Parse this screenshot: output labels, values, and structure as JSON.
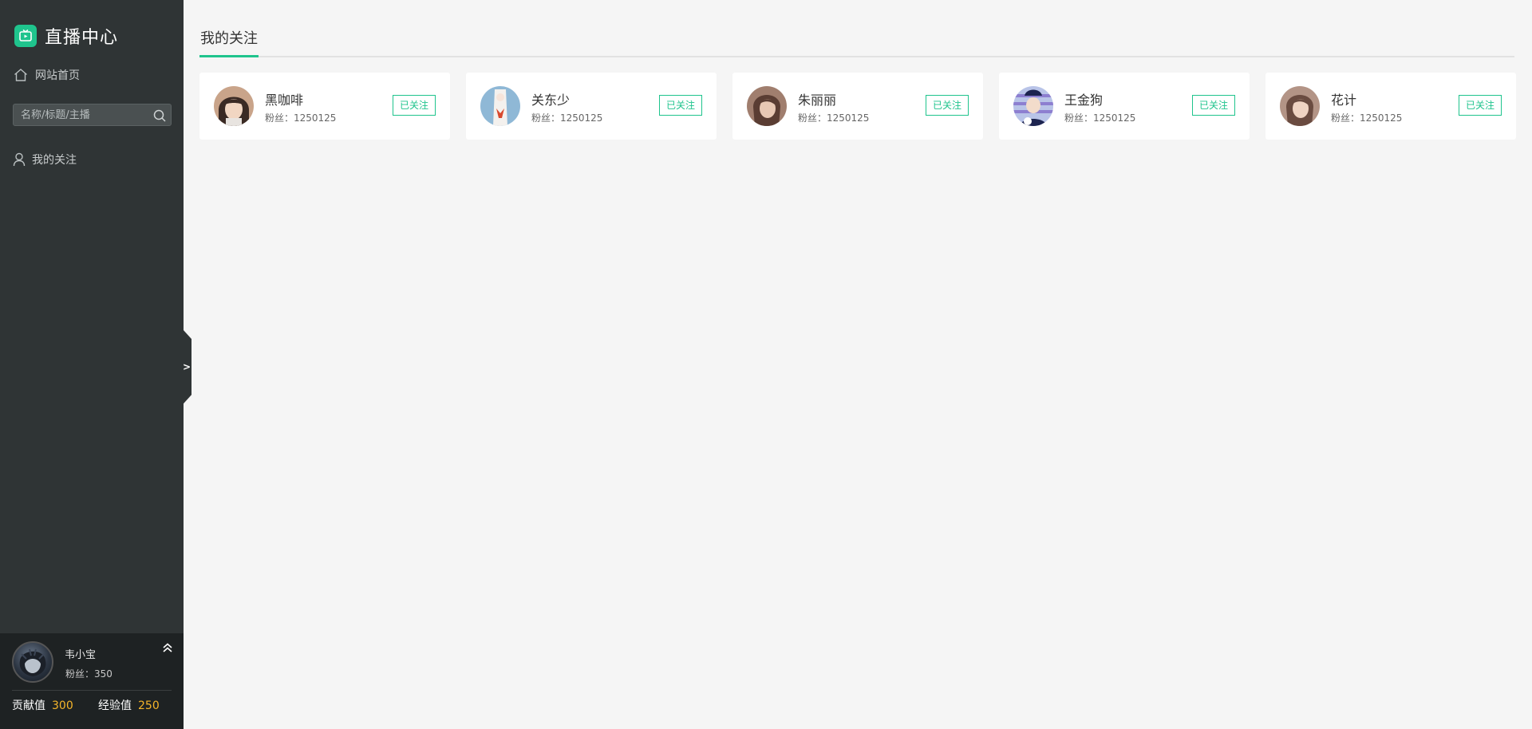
{
  "sidebar": {
    "brand": "直播中心",
    "home_label": "网站首页",
    "search_placeholder": "名称/标题/主播",
    "follow_label": "我的关注",
    "collapse_glyph": ">"
  },
  "user": {
    "name": "韦小宝",
    "fans": "粉丝：350",
    "contribution_label": "贡献值",
    "contribution_value": "300",
    "experience_label": "经验值",
    "experience_value": "250"
  },
  "main": {
    "title": "我的关注"
  },
  "follows": [
    {
      "name": "黑咖啡",
      "fans": "粉丝：1250125",
      "status": "已关注",
      "avatar": "avatar-1"
    },
    {
      "name": "关东少",
      "fans": "粉丝：1250125",
      "status": "已关注",
      "avatar": "avatar-2"
    },
    {
      "name": "朱丽丽",
      "fans": "粉丝：1250125",
      "status": "已关注",
      "avatar": "avatar-3"
    },
    {
      "name": "王金狗",
      "fans": "粉丝：1250125",
      "status": "已关注",
      "avatar": "avatar-4"
    },
    {
      "name": "花计",
      "fans": "粉丝：1250125",
      "status": "已关注",
      "avatar": "avatar-5"
    }
  ],
  "colors": {
    "accent": "#1fc48d",
    "sidebar_bg": "#2f3435",
    "user_panel_bg": "#1e2223",
    "stat_value": "#f5b52a"
  }
}
